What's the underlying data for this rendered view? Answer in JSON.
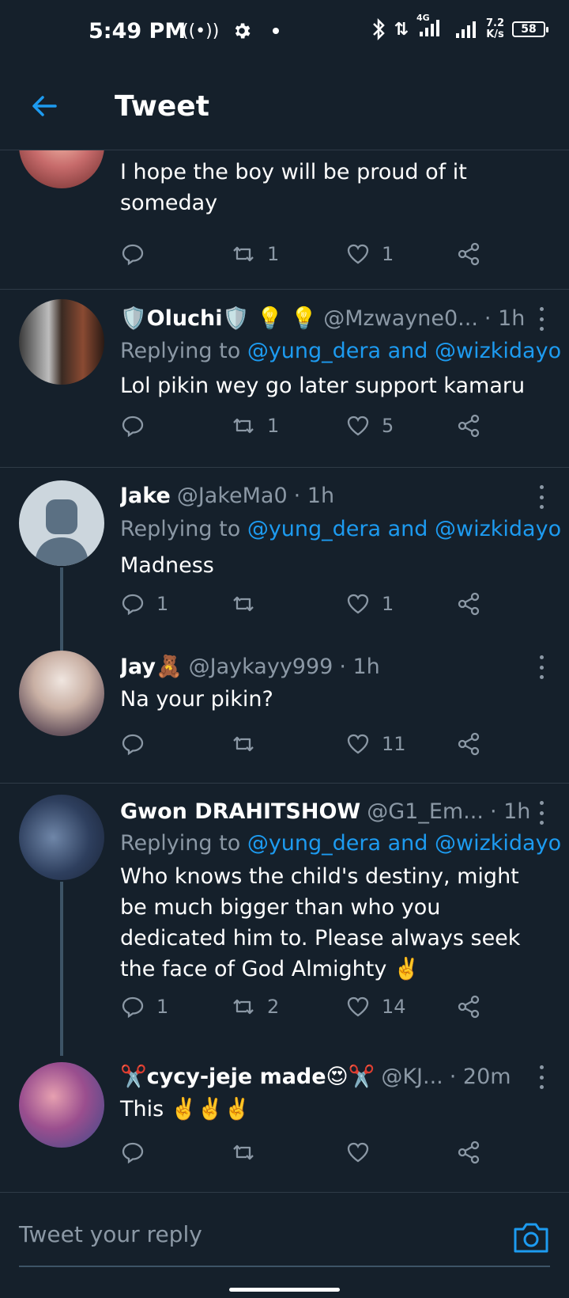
{
  "status_bar": {
    "time": "5:49 PM",
    "network_type": "4G",
    "speed_value": "7.2",
    "speed_unit": "K/s",
    "battery": "58"
  },
  "header": {
    "title": "Tweet"
  },
  "tweets": [
    {
      "text_line1": "I hope the boy will be proud of it",
      "text_line2": "someday",
      "replies": "",
      "retweets": "1",
      "likes": "1"
    },
    {
      "name": "🛡️Oluchi🛡️ 💡 💡",
      "handle": "@Mzwayne0...",
      "time": "· 1h",
      "replying_prefix": "Replying to",
      "replying_to": "@yung_dera and @wizkidayo",
      "text": "Lol pikin wey go later support kamaru",
      "replies": "",
      "retweets": "1",
      "likes": "5"
    },
    {
      "name": "Jake",
      "handle": "@JakeMa0",
      "time": "· 1h",
      "replying_prefix": "Replying to",
      "replying_to": "@yung_dera and @wizkidayo",
      "text": "Madness",
      "replies": "1",
      "retweets": "",
      "likes": "1"
    },
    {
      "name": "Jay🧸",
      "handle": "@Jaykayy999",
      "time": "· 1h",
      "text": "Na your pikin?",
      "replies": "",
      "retweets": "",
      "likes": "11"
    },
    {
      "name": "Gwon DRAHITSHOW",
      "handle": "@G1_Em...",
      "time": "· 1h",
      "replying_prefix": "Replying to",
      "replying_to": "@yung_dera and @wizkidayo",
      "text": "Who knows the child's destiny, might be much bigger than who you dedicated him to. Please always seek the face of God Almighty ✌️",
      "replies": "1",
      "retweets": "2",
      "likes": "14"
    },
    {
      "name": "✂️cycy-jeje made😍✂️",
      "handle": "@KJ...",
      "time": "· 20m",
      "text": "This ✌️✌️✌️",
      "replies": "",
      "retweets": "",
      "likes": ""
    }
  ],
  "reply_bar": {
    "placeholder": "Tweet your reply"
  }
}
